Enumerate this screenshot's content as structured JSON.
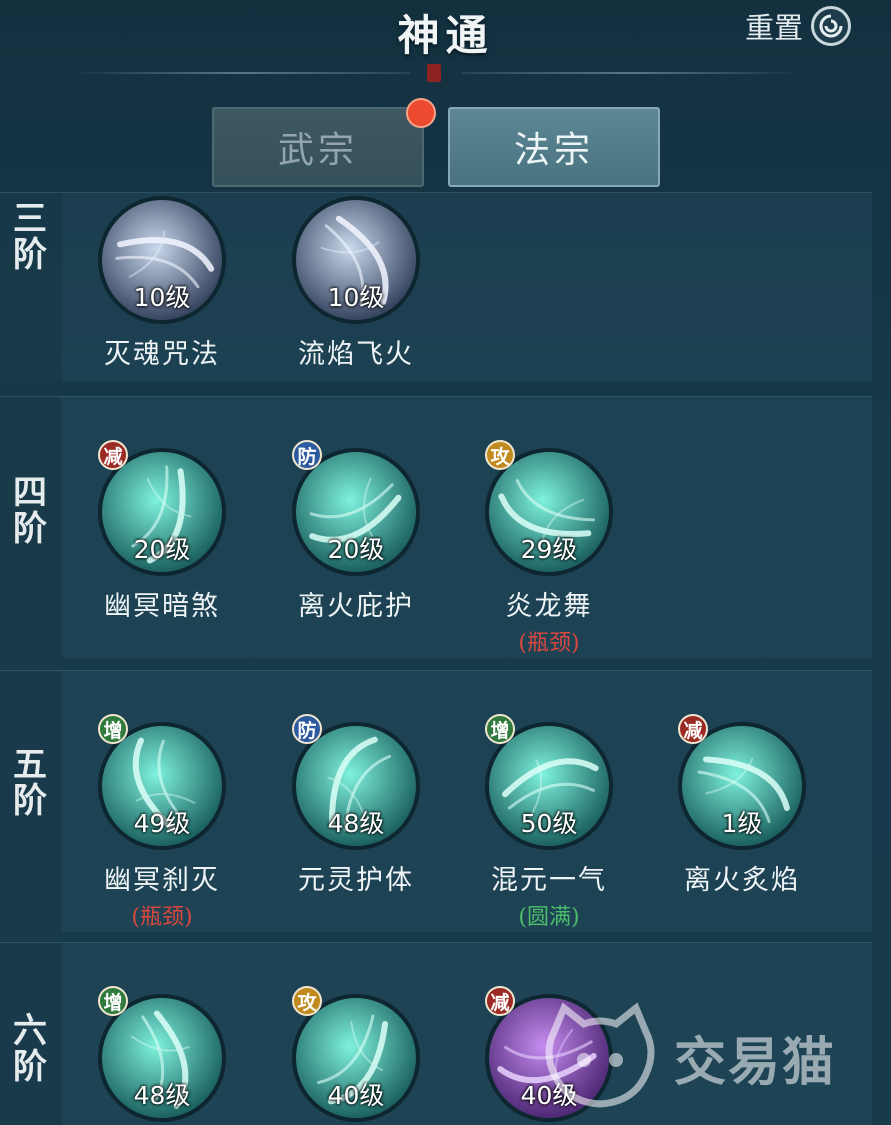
{
  "header": {
    "title": "神通",
    "reset_label": "重置"
  },
  "tabs": [
    {
      "label": "武宗",
      "active": false,
      "has_dot": true
    },
    {
      "label": "法宗",
      "active": true
    }
  ],
  "tiers": [
    {
      "label": [
        "三",
        "阶"
      ],
      "skills": [
        {
          "name": "灭魂咒法",
          "level": "10级",
          "badge": null,
          "theme": "blue-white"
        },
        {
          "name": "流焰飞火",
          "level": "10级",
          "badge": null,
          "theme": "blue-white"
        }
      ]
    },
    {
      "label": [
        "四",
        "阶"
      ],
      "skills": [
        {
          "name": "幽冥暗煞",
          "level": "20级",
          "badge": {
            "text": "减",
            "color": "#9b2a24"
          },
          "theme": "teal"
        },
        {
          "name": "离火庇护",
          "level": "20级",
          "badge": {
            "text": "防",
            "color": "#2b5aa0"
          },
          "theme": "teal"
        },
        {
          "name": "炎龙舞",
          "level": "29级",
          "badge": {
            "text": "攻",
            "color": "#c08a1f"
          },
          "theme": "teal",
          "note": "(瓶颈)",
          "note_type": "red"
        }
      ]
    },
    {
      "label": [
        "五",
        "阶"
      ],
      "skills": [
        {
          "name": "幽冥刹灭",
          "level": "49级",
          "badge": {
            "text": "增",
            "color": "#2f7a3c"
          },
          "theme": "teal",
          "note": "(瓶颈)",
          "note_type": "red"
        },
        {
          "name": "元灵护体",
          "level": "48级",
          "badge": {
            "text": "防",
            "color": "#2b5aa0"
          },
          "theme": "teal"
        },
        {
          "name": "混元一气",
          "level": "50级",
          "badge": {
            "text": "增",
            "color": "#2f7a3c"
          },
          "theme": "teal",
          "note": "(圆满)",
          "note_type": "green"
        },
        {
          "name": "离火炙焰",
          "level": "1级",
          "badge": {
            "text": "减",
            "color": "#9b2a24"
          },
          "theme": "teal"
        }
      ]
    },
    {
      "label": [
        "六",
        "阶"
      ],
      "skills": [
        {
          "name": "",
          "level": "48级",
          "badge": {
            "text": "增",
            "color": "#2f7a3c"
          },
          "theme": "teal"
        },
        {
          "name": "",
          "level": "40级",
          "badge": {
            "text": "攻",
            "color": "#c08a1f"
          },
          "theme": "teal"
        },
        {
          "name": "",
          "level": "40级",
          "badge": {
            "text": "减",
            "color": "#9b2a24"
          },
          "theme": "purple"
        }
      ]
    }
  ],
  "watermark": {
    "text": "交易猫"
  },
  "colors": {
    "teal": "#3ed6c0",
    "purple": "#8a4fd0",
    "badge_border": "#f0e6d0"
  }
}
